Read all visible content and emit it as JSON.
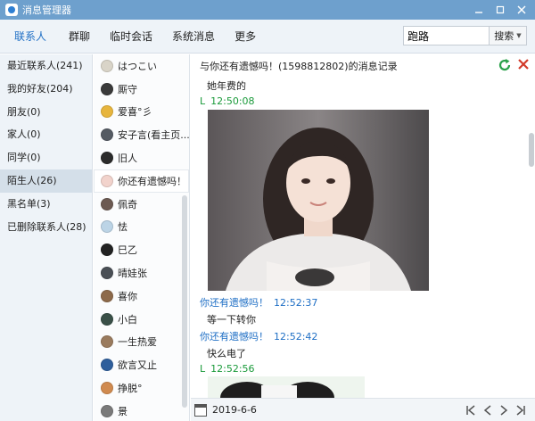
{
  "window": {
    "title": "消息管理器",
    "controls": [
      "minimize-icon",
      "maximize-icon",
      "close-icon"
    ]
  },
  "nav": {
    "tabs": [
      {
        "label": "联系人",
        "active": true
      },
      {
        "label": "群聊"
      },
      {
        "label": "临时会话"
      },
      {
        "label": "系统消息"
      },
      {
        "label": "更多"
      }
    ],
    "search_value": "跑路",
    "search_button": "搜索"
  },
  "categories": [
    "最近联系人(241)",
    "我的好友(204)",
    "朋友(0)",
    "家人(0)",
    "同学(0)",
    "陌生人(26)",
    "黑名单(3)",
    "已删除联系人(28)"
  ],
  "selected_category": 5,
  "contacts": [
    {
      "name": "はつこい",
      "avatar_color": "#d9d4c8"
    },
    {
      "name": "厮守",
      "avatar_color": "#3a3a3a"
    },
    {
      "name": "爱喜°彡",
      "avatar_color": "#e7b53d"
    },
    {
      "name": "安子言(看主页...",
      "avatar_color": "#555b63"
    },
    {
      "name": "旧人",
      "avatar_color": "#2b2b2b"
    },
    {
      "name": "你还有遗憾吗！",
      "avatar_color": "#f2d3cc"
    },
    {
      "name": "佩奇",
      "avatar_color": "#6c5a52"
    },
    {
      "name": "怯",
      "avatar_color": "#bcd4e6"
    },
    {
      "name": "巳乙",
      "avatar_color": "#222222"
    },
    {
      "name": "晴娃张",
      "avatar_color": "#4a4f55"
    },
    {
      "name": "喜你",
      "avatar_color": "#8d6a4a"
    },
    {
      "name": "小白",
      "avatar_color": "#3a5048"
    },
    {
      "name": "一生热爱",
      "avatar_color": "#9a7b5e"
    },
    {
      "name": "欲言又止",
      "avatar_color": "#2f5f9c"
    },
    {
      "name": "挣脱°",
      "avatar_color": "#d08a4f"
    },
    {
      "name": "景",
      "avatar_color": "#7a7a7a"
    }
  ],
  "selected_contact": 5,
  "conversation": {
    "header": "与你还有遗憾吗！(1598812802)的消息记录",
    "messages": [
      {
        "text": "她年费的"
      },
      {
        "sender": "L",
        "time": "12:50:08",
        "color": "#1a9a3a"
      },
      {
        "sender": "你还有遗憾吗！",
        "time": "12:52:37",
        "color": "#1f6fc5"
      },
      {
        "text": "等一下转你"
      },
      {
        "sender": "你还有遗憾吗！",
        "time": "12:52:42",
        "color": "#1f6fc5"
      },
      {
        "text": "快么电了"
      },
      {
        "sender": "L",
        "time": "12:52:56",
        "color": "#1a9a3a"
      }
    ]
  },
  "bottom": {
    "date": "2019-6-6",
    "pager": [
      "first-page-icon",
      "prev-page-icon",
      "next-page-icon",
      "last-page-icon"
    ]
  }
}
